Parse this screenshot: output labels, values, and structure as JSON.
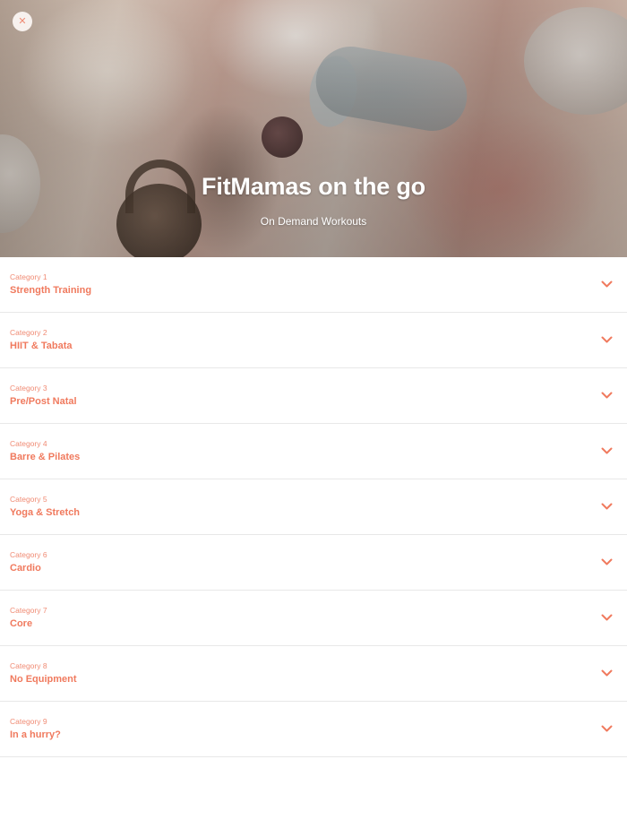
{
  "hero": {
    "title": "FitMamas on the go",
    "subtitle": "On Demand Workouts",
    "close_icon": "close-icon"
  },
  "colors": {
    "accent": "#f07a5e",
    "accent_light": "#f08b74",
    "divider": "#e8e8e8"
  },
  "categories": [
    {
      "kicker": "Category 1",
      "name": "Strength Training"
    },
    {
      "kicker": "Category 2",
      "name": "HIIT & Tabata"
    },
    {
      "kicker": "Category 3",
      "name": "Pre/Post Natal"
    },
    {
      "kicker": "Category 4",
      "name": "Barre & Pilates"
    },
    {
      "kicker": "Category 5",
      "name": "Yoga & Stretch"
    },
    {
      "kicker": "Category 6",
      "name": "Cardio"
    },
    {
      "kicker": "Category 7",
      "name": "Core"
    },
    {
      "kicker": "Category 8",
      "name": "No Equipment"
    },
    {
      "kicker": "Category 9",
      "name": "In a hurry?"
    }
  ]
}
